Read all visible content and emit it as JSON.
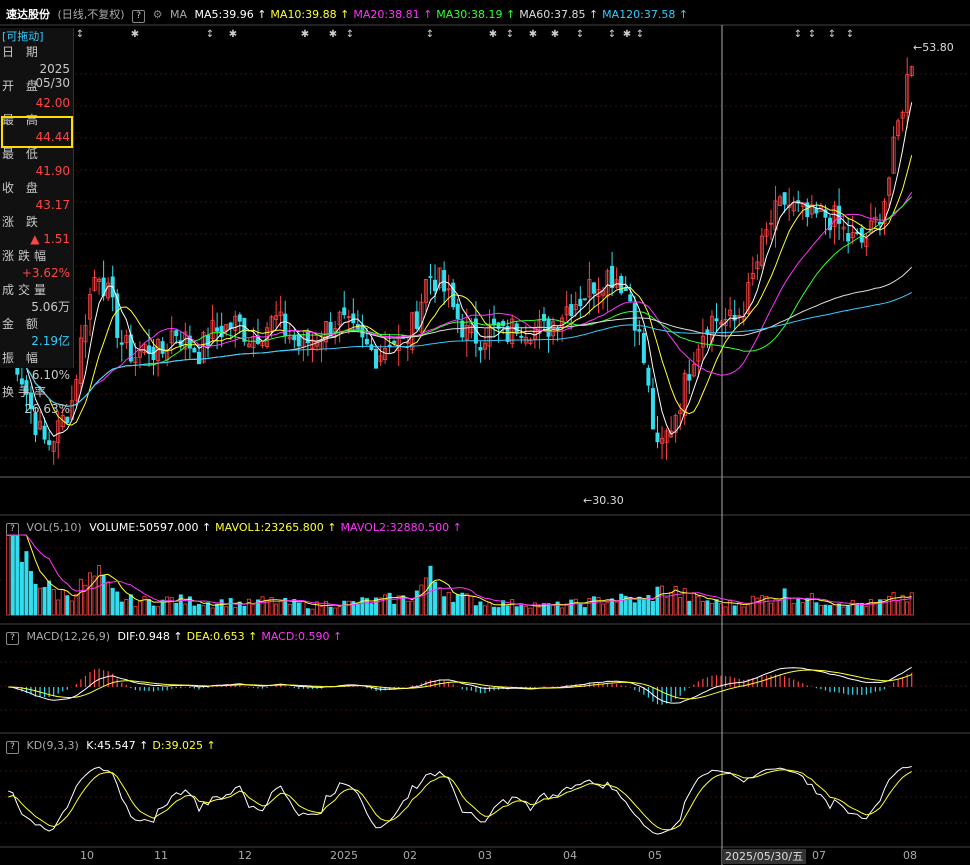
{
  "header": {
    "stock_name": "速达股份",
    "period": "(日线,不复权)",
    "ma_label": "MA",
    "ma_items": [
      {
        "text": "MA5:39.96",
        "color": "#ffffff"
      },
      {
        "text": "MA10:39.88",
        "color": "#ffff33"
      },
      {
        "text": "MA20:38.81",
        "color": "#ff33ff"
      },
      {
        "text": "MA30:38.19",
        "color": "#33ff33"
      },
      {
        "text": "MA60:37.85",
        "color": "#dddddd"
      },
      {
        "text": "MA120:37.58",
        "color": "#33ccff"
      }
    ]
  },
  "info_panel": {
    "draggable": "[可拖动]",
    "rows": [
      {
        "label": "日 期",
        "value": "2025",
        "value2": "05/30",
        "color": "#c8c8c8"
      },
      {
        "label": "开 盘",
        "value": "42.00",
        "color": "#ff4444"
      },
      {
        "label": "最 高",
        "value": "44.44",
        "color": "#ff4444"
      },
      {
        "label": "最 低",
        "value": "41.90",
        "color": "#ff4444"
      },
      {
        "label": "收 盘",
        "value": "43.17",
        "color": "#ff4444"
      },
      {
        "label": "涨 跌",
        "value": "▲ 1.51",
        "color": "#ff4444"
      },
      {
        "label": "涨跌幅",
        "value": "+3.62%",
        "color": "#ff4444"
      },
      {
        "label": "成交量",
        "value": "5.06万",
        "color": "#c8c8c8"
      },
      {
        "label": "金 额",
        "value": "2.19亿",
        "color": "#33ccff"
      },
      {
        "label": "振 幅",
        "value": "6.10%",
        "color": "#c8c8c8"
      },
      {
        "label": "换手率",
        "value": "26.63%",
        "color": "#c8c8c8"
      }
    ]
  },
  "price_markers": {
    "high": "53.80",
    "low": "30.30"
  },
  "vol_header": {
    "label": "VOL(5,10)",
    "items": [
      {
        "text": "VOLUME:50597.000",
        "color": "#ffffff"
      },
      {
        "text": "MAVOL1:23265.800",
        "color": "#ffff33"
      },
      {
        "text": "MAVOL2:32880.500",
        "color": "#ff33ff"
      }
    ]
  },
  "macd_header": {
    "label": "MACD(12,26,9)",
    "items": [
      {
        "text": "DIF:0.948",
        "color": "#ffffff"
      },
      {
        "text": "DEA:0.653",
        "color": "#ffff33"
      },
      {
        "text": "MACD:0.590",
        "color": "#ff33ff"
      }
    ]
  },
  "kd_header": {
    "label": "KD(9,3,3)",
    "items": [
      {
        "text": "K:45.547",
        "color": "#ffffff"
      },
      {
        "text": "D:39.025",
        "color": "#ffff33"
      }
    ]
  },
  "x_axis": {
    "labels": [
      "10",
      "11",
      "12",
      "2025",
      "02",
      "03",
      "04",
      "05",
      "07",
      "08"
    ],
    "crosshair_date": "2025/05/30/五"
  },
  "chart_data": {
    "type": "candlestick",
    "price_range": [
      29,
      55
    ],
    "min_price": 30.3,
    "max_price": 53.8,
    "series": [
      {
        "name": "MA5",
        "value": 39.96
      },
      {
        "name": "MA10",
        "value": 39.88
      },
      {
        "name": "MA20",
        "value": 38.81
      },
      {
        "name": "MA30",
        "value": 38.19
      },
      {
        "name": "MA60",
        "value": 37.85
      },
      {
        "name": "MA120",
        "value": 37.58
      }
    ],
    "close_path": [
      38,
      36,
      33.5,
      32,
      33,
      34.5,
      39,
      42,
      40,
      37.5,
      37,
      37.5,
      37,
      38.5,
      37.8,
      37.2,
      38.3,
      38.5,
      38.8,
      38,
      38.5,
      39,
      38.2,
      37.5,
      38,
      38.5,
      39,
      38.2,
      37.5,
      37,
      38,
      37.5,
      39,
      41.5,
      41,
      39.5,
      38.2,
      38,
      38.5,
      38,
      38.8,
      38.6,
      38.3,
      39,
      39.8,
      40.2,
      41,
      41.5,
      41.3,
      40,
      36.5,
      31.5,
      33,
      35,
      37.5,
      39,
      39,
      38.8,
      40,
      42.5,
      44.5,
      45.5,
      45,
      44.5,
      44.8,
      44.5,
      43.5,
      43.2,
      44,
      46,
      50,
      53.5
    ],
    "volume_path": [
      35,
      26,
      18,
      12,
      9,
      10,
      13,
      17,
      10,
      7,
      6,
      6,
      6,
      7,
      6,
      6,
      5,
      6,
      5,
      5,
      6,
      6,
      5,
      5,
      4,
      5,
      5,
      5,
      6,
      6,
      7,
      7,
      9,
      17,
      13,
      9,
      7,
      6,
      5,
      5,
      5,
      5,
      4,
      4,
      5,
      5,
      6,
      7,
      7,
      7,
      6,
      10,
      11,
      9,
      7,
      6,
      5,
      5,
      6,
      7,
      8,
      9,
      8,
      7,
      6,
      6,
      5,
      5,
      5,
      6,
      8,
      7
    ]
  }
}
